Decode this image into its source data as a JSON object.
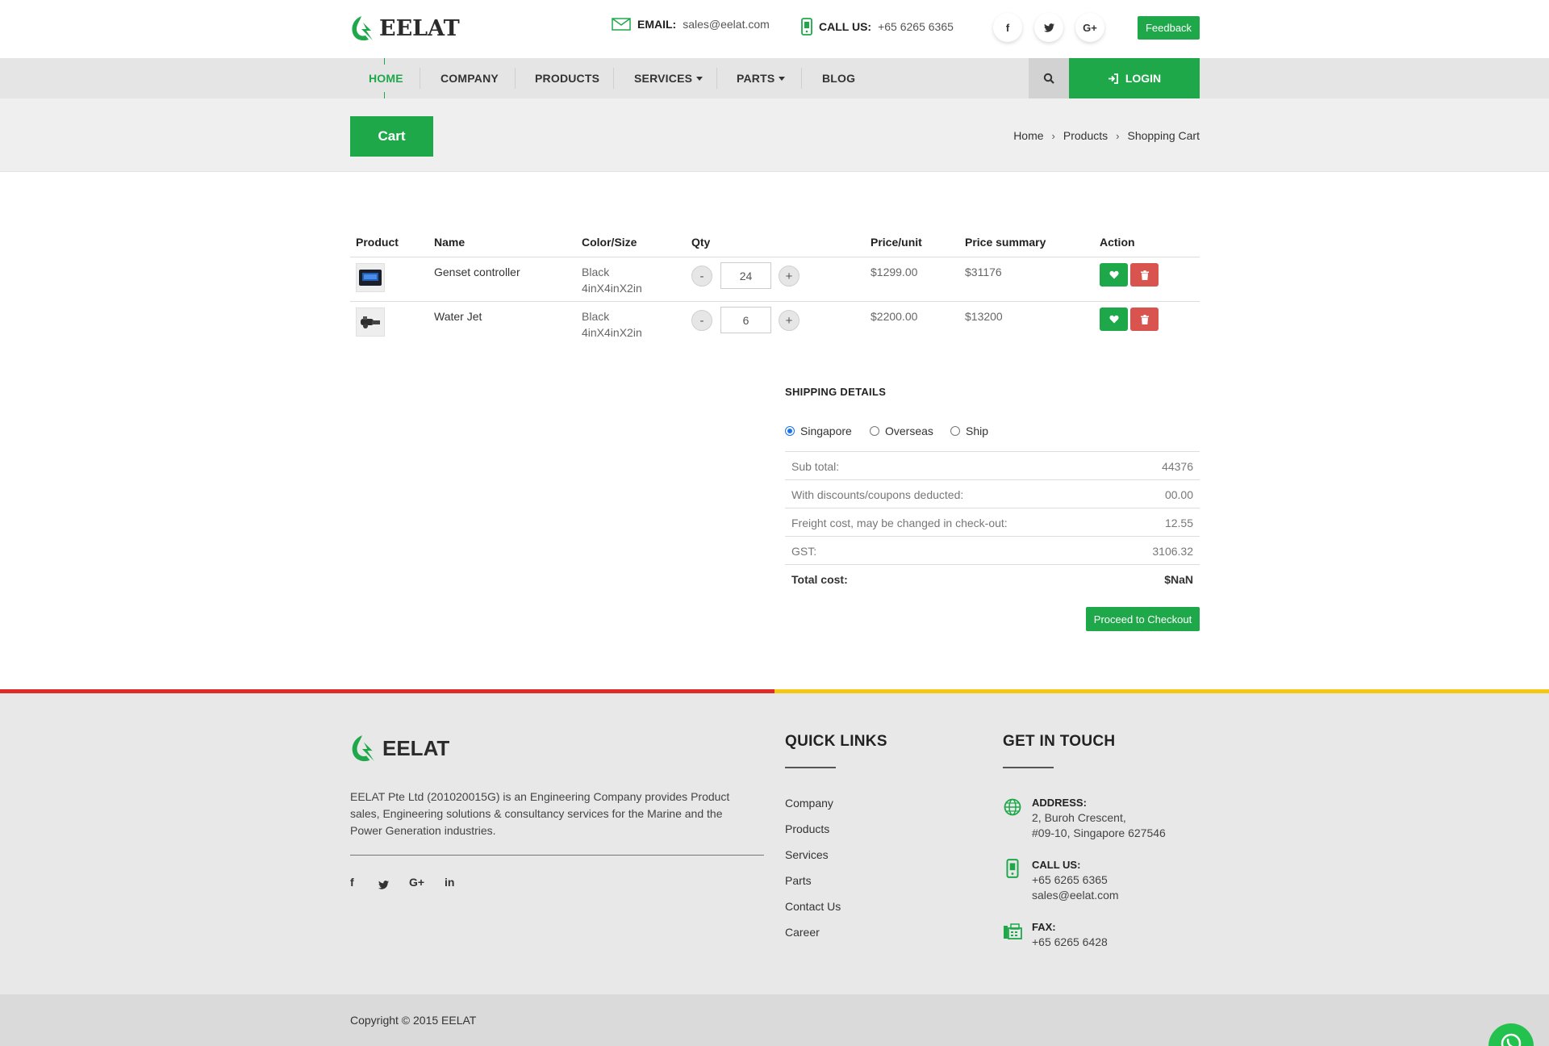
{
  "brand": {
    "name": "EELAT",
    "color": "#1fa84a"
  },
  "topbar": {
    "email_label": "EMAIL:",
    "email_value": "sales@eelat.com",
    "phone_label": "CALL US:",
    "phone_value": "+65 6265 6365",
    "social": [
      "f",
      "t",
      "G+"
    ],
    "feedback_label": "Feedback"
  },
  "nav": {
    "items": [
      {
        "label": "HOME"
      },
      {
        "label": "COMPANY"
      },
      {
        "label": "PRODUCTS"
      },
      {
        "label": "SERVICES"
      },
      {
        "label": "PARTS"
      },
      {
        "label": "BLOG"
      }
    ],
    "login_label": "LOGIN"
  },
  "page": {
    "title": "Cart",
    "breadcrumb": [
      "Home",
      "Products",
      "Shopping Cart"
    ]
  },
  "cart": {
    "columns": [
      "Product",
      "Name",
      "Color/Size",
      "Qty",
      "Price/unit",
      "Price summary",
      "Action"
    ],
    "rows": [
      {
        "name": "Genset controller",
        "color": "Black",
        "size": "4inX4inX2in",
        "qty": "24",
        "price_unit": "$1299.00",
        "price_summary": "$31176"
      },
      {
        "name": "Water Jet",
        "color": "Black",
        "size": "4inX4inX2in",
        "qty": "6",
        "price_unit": "$2200.00",
        "price_summary": "$13200"
      }
    ],
    "minus": "-",
    "plus": "+"
  },
  "shipping": {
    "title": "SHIPPING DETAILS",
    "options": [
      {
        "label": "Singapore",
        "selected": true
      },
      {
        "label": "Overseas",
        "selected": false
      },
      {
        "label": "Ship",
        "selected": false
      }
    ],
    "summary": [
      {
        "label": "Sub total:",
        "value": "44376"
      },
      {
        "label": "With discounts/coupons deducted:",
        "value": "00.00"
      },
      {
        "label": "Freight cost, may be changed in check-out:",
        "value": "12.55"
      },
      {
        "label": "GST:",
        "value": "3106.32"
      },
      {
        "label": "Total cost:",
        "value": "$NaN"
      }
    ],
    "checkout_label": "Proceed to Checkout"
  },
  "footer": {
    "brand": "EELAT",
    "about": "EELAT Pte Ltd (201020015G) is an Engineering Company provides Product sales, Engineering solutions & consultancy services for the Marine and the Power Generation industries.",
    "social": [
      "f",
      "t",
      "G+",
      "in"
    ],
    "quick_links_title": "QUICK LINKS",
    "quick_links": [
      "Company",
      "Products",
      "Services",
      "Parts",
      "Contact Us",
      "Career"
    ],
    "touch_title": "GET IN TOUCH",
    "address_label": "ADDRESS:",
    "address_line1": "2, Buroh Crescent,",
    "address_line2": "#09-10, Singapore 627546",
    "call_label": "CALL US:",
    "call_phone": "+65 6265 6365",
    "call_email": "sales@eelat.com",
    "fax_label": "FAX:",
    "fax_value": "+65 6265 6428",
    "copyright": "Copyright © 2015 EELAT"
  }
}
